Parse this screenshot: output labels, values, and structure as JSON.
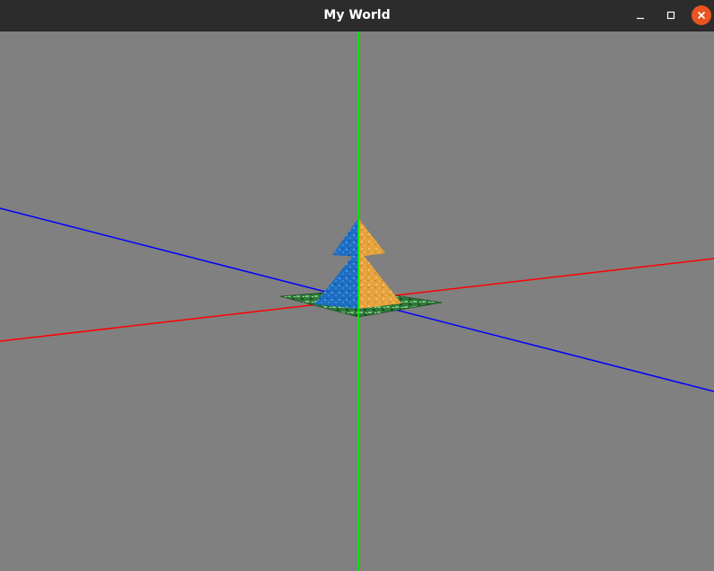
{
  "window": {
    "title": "My World",
    "controls": {
      "minimize_icon": "minimize-icon",
      "maximize_icon": "maximize-icon",
      "close_icon": "close-icon",
      "close_color": "#e95420"
    }
  },
  "scene": {
    "background_color": "#808080",
    "axes": {
      "x_color": "#ff0000",
      "y_color": "#00ff00",
      "z_color": "#0000ff"
    },
    "objects": [
      "textured-ground-tile",
      "two-tier-pyramid-tree"
    ],
    "tree_colors": {
      "left_face": "#1e6fc4",
      "right_face": "#e6a23c"
    },
    "ground_color": "#2f7a3a"
  }
}
